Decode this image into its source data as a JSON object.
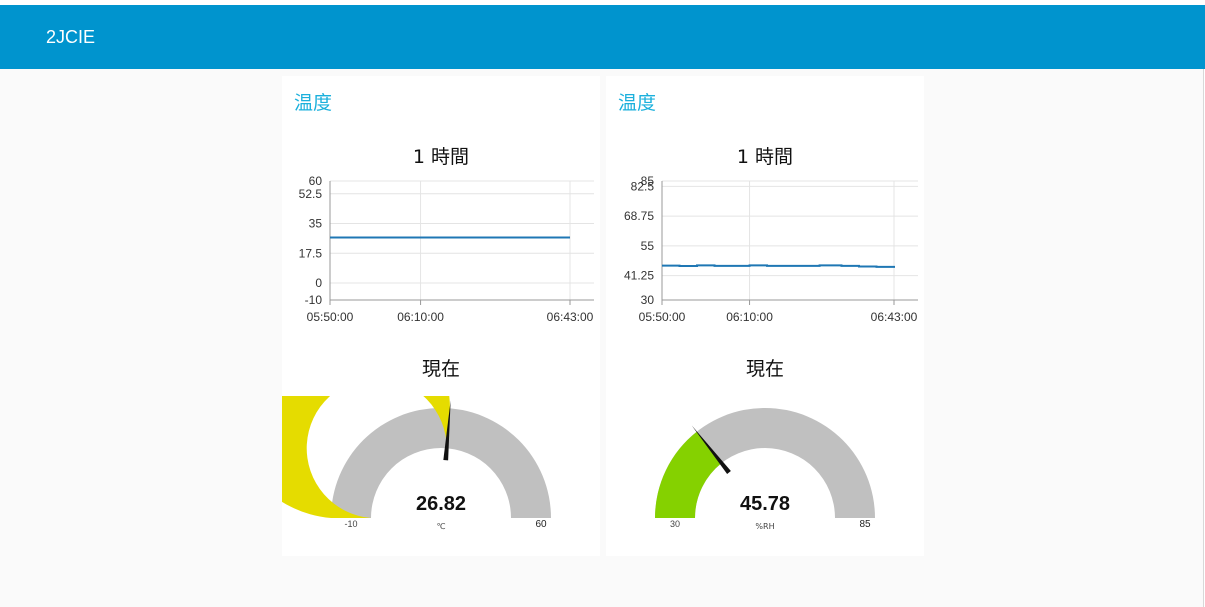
{
  "app": {
    "title": "2JCIE",
    "header_color": "#0094ce"
  },
  "cards": [
    {
      "title": "温度",
      "chart_label": "1 時間",
      "gauge_label": "現在",
      "chart_data": {
        "type": "line",
        "x_ticks": [
          "05:50:00",
          "06:10:00",
          "06:43:00"
        ],
        "y_ticks": [
          "60",
          "52.5",
          "35",
          "17.5",
          "0",
          "-10"
        ],
        "ylim": [
          -10,
          60
        ],
        "grid": true,
        "series": [
          {
            "color": "#1f77b4",
            "x": [
              "05:50:00",
              "06:43:00"
            ],
            "values": [
              26.8,
              26.8
            ]
          }
        ]
      },
      "gauge": {
        "value": "26.82",
        "unit": "℃",
        "min": "-10",
        "max": "60",
        "value_num": 26.82,
        "min_num": -10,
        "max_num": 60,
        "fill_color": "#e5dc00",
        "track_color": "#c0c0c0"
      }
    },
    {
      "title": "温度",
      "chart_label": "1 時間",
      "gauge_label": "現在",
      "chart_data": {
        "type": "line",
        "x_ticks": [
          "05:50:00",
          "06:10:00",
          "06:43:00"
        ],
        "y_ticks": [
          "85",
          "82.5",
          "68.75",
          "55",
          "41.25",
          "30"
        ],
        "ylim": [
          30,
          85
        ],
        "grid": true,
        "series": [
          {
            "color": "#1f77b4",
            "x": [
              "05:50:00",
              "05:54:00",
              "05:58:00",
              "06:02:00",
              "06:06:00",
              "06:10:00",
              "06:14:00",
              "06:20:00",
              "06:26:00",
              "06:31:00",
              "06:35:00",
              "06:39:00",
              "06:43:00"
            ],
            "values": [
              45.9,
              45.7,
              46.0,
              45.8,
              45.8,
              46.0,
              45.8,
              45.8,
              46.0,
              45.8,
              45.5,
              45.3,
              45.8
            ]
          }
        ]
      },
      "gauge": {
        "value": "45.78",
        "unit": "%RH",
        "min": "30",
        "max": "85",
        "value_num": 45.78,
        "min_num": 30,
        "max_num": 85,
        "fill_color": "#85d100",
        "track_color": "#c0c0c0"
      }
    }
  ]
}
